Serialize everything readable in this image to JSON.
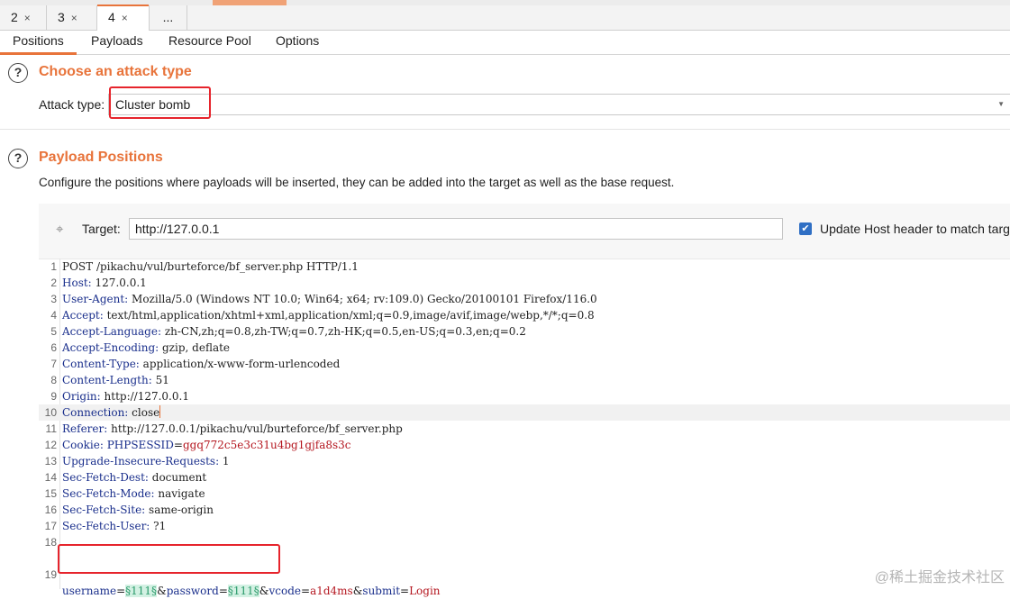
{
  "request_tabs": [
    {
      "label": "2",
      "close": "×",
      "active": false
    },
    {
      "label": "3",
      "close": "×",
      "active": false
    },
    {
      "label": "4",
      "close": "×",
      "active": true
    },
    {
      "label": "...",
      "close": "",
      "active": false
    }
  ],
  "subtabs": [
    "Positions",
    "Payloads",
    "Resource Pool",
    "Options"
  ],
  "attack": {
    "title": "Choose an attack type",
    "label": "Attack type:",
    "value": "Cluster bomb"
  },
  "positions": {
    "title": "Payload Positions",
    "description": "Configure the positions where payloads will be inserted, they can be added into the target as well as the base request.",
    "target_label": "Target:",
    "target_value": "http://127.0.0.1",
    "update_host_label": "Update Host header to match targ"
  },
  "request_lines": [
    {
      "n": "1",
      "k": "",
      "v": "POST /pikachu/vul/burteforce/bf_server.php HTTP/1.1"
    },
    {
      "n": "2",
      "k": "Host:",
      "v": " 127.0.0.1"
    },
    {
      "n": "3",
      "k": "User-Agent:",
      "v": " Mozilla/5.0 (Windows NT 10.0; Win64; x64; rv:109.0) Gecko/20100101 Firefox/116.0"
    },
    {
      "n": "4",
      "k": "Accept:",
      "v": " text/html,application/xhtml+xml,application/xml;q=0.9,image/avif,image/webp,*/*;q=0.8"
    },
    {
      "n": "5",
      "k": "Accept-Language:",
      "v": " zh-CN,zh;q=0.8,zh-TW;q=0.7,zh-HK;q=0.5,en-US;q=0.3,en;q=0.2"
    },
    {
      "n": "6",
      "k": "Accept-Encoding:",
      "v": " gzip, deflate"
    },
    {
      "n": "7",
      "k": "Content-Type:",
      "v": " application/x-www-form-urlencoded"
    },
    {
      "n": "8",
      "k": "Content-Length:",
      "v": " 51"
    },
    {
      "n": "9",
      "k": "Origin:",
      "v": " http://127.0.0.1"
    },
    {
      "n": "10",
      "k": "Connection:",
      "v": " close"
    },
    {
      "n": "11",
      "k": "Referer:",
      "v": " http://127.0.0.1/pikachu/vul/burteforce/bf_server.php"
    },
    {
      "n": "12",
      "k": "Cookie:",
      "v": " ",
      "ck": "PHPSESSID",
      "cv": "ggq772c5e3c31u4bg1gjfa8s3c"
    },
    {
      "n": "13",
      "k": "Upgrade-Insecure-Requests:",
      "v": " 1"
    },
    {
      "n": "14",
      "k": "Sec-Fetch-Dest:",
      "v": " document"
    },
    {
      "n": "15",
      "k": "Sec-Fetch-Mode:",
      "v": " navigate"
    },
    {
      "n": "16",
      "k": "Sec-Fetch-Site:",
      "v": " same-origin"
    },
    {
      "n": "17",
      "k": "Sec-Fetch-User:",
      "v": " ?1"
    },
    {
      "n": "18",
      "k": "",
      "v": ""
    }
  ],
  "body_line": {
    "n": "19",
    "p1": "username",
    "m1": "§111§",
    "p2": "password",
    "m2": "§111§",
    "p3": "vcode",
    "v3": "a1d4ms",
    "p4": "submit",
    "v4": "Login"
  },
  "watermark": "@稀土掘金技术社区",
  "colors": {
    "accent": "#e8743b",
    "highlight_box": "#e6242c",
    "marker_bg": "#d3f1e3",
    "key": "#1a2f8c",
    "cookie_value": "#b4161f"
  }
}
